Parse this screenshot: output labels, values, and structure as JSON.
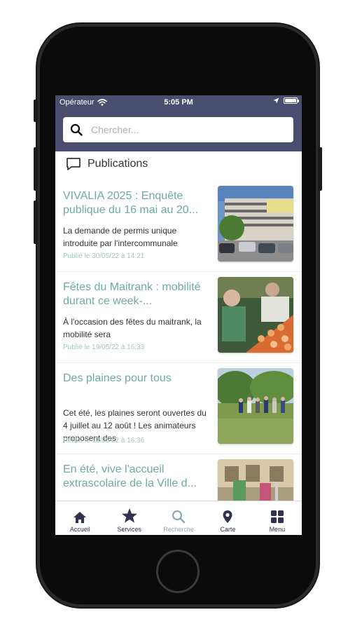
{
  "status_bar": {
    "carrier": "Opérateur",
    "time": "5:05 PM"
  },
  "search": {
    "placeholder": "Chercher..."
  },
  "section": {
    "title": "Publications"
  },
  "publications": [
    {
      "title": "VIVALIA 2025 : Enquête publique du 16 mai au 20...",
      "excerpt": "La demande de permis unique introduite par l'intercommunale",
      "date": "Publié le 30/05/22 à 14:21"
    },
    {
      "title": "Fêtes du Maitrank : mobilité durant ce week-...",
      "excerpt": "À l'occasion des fêtes du maitrank, la mobilité sera",
      "date": "Publié le 19/05/22 à 16:33"
    },
    {
      "title": "Des plaines pour tous",
      "excerpt": "Cet été, les plaines seront ouvertes du 4 juillet au 12 août ! Les animateurs proposent des",
      "date": "Publié le 13/05/22 à 16:36"
    },
    {
      "title": "En été, vive l'accueil extrascolaire de la Ville d...",
      "excerpt": "",
      "date": ""
    }
  ],
  "tabs": [
    {
      "label": "Accueil",
      "icon": "home-icon"
    },
    {
      "label": "Services",
      "icon": "star-icon"
    },
    {
      "label": "Recherche",
      "icon": "search-icon",
      "active": true
    },
    {
      "label": "Carte",
      "icon": "map-pin-icon"
    },
    {
      "label": "Menu",
      "icon": "grid-icon"
    }
  ],
  "colors": {
    "header": "#4a4e6e",
    "title_teal": "#6fa9a5",
    "date_teal": "#9cc7c4",
    "tab_dark": "#2f3350",
    "tab_active": "#8aa7b4"
  }
}
